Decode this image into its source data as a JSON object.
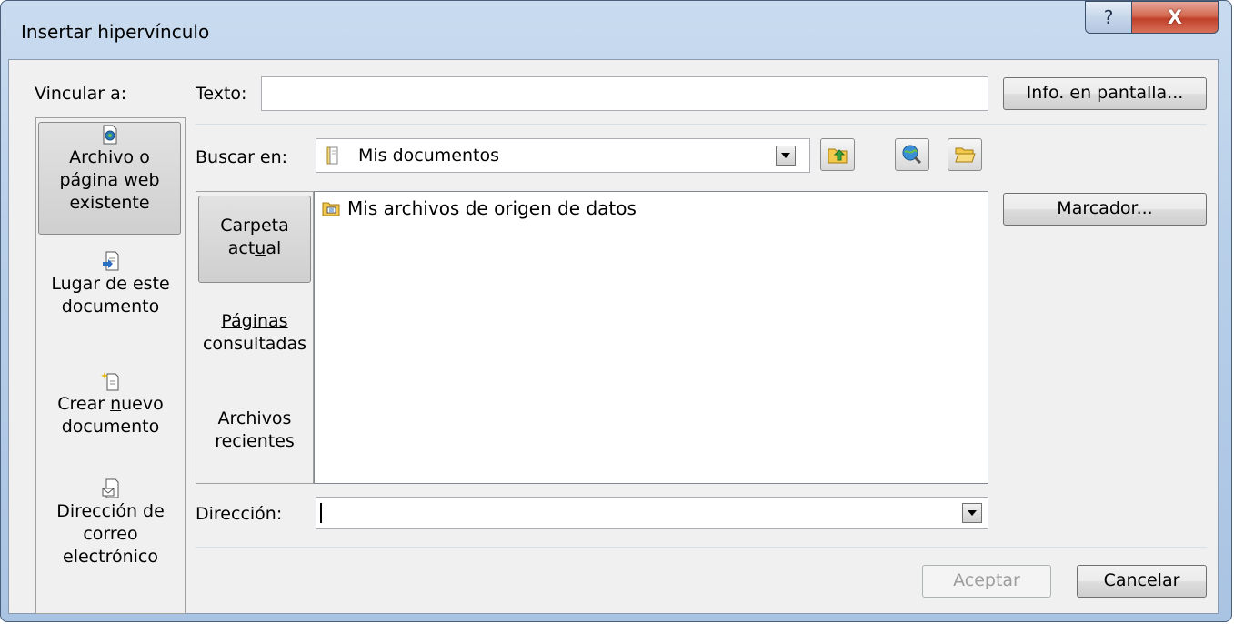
{
  "window": {
    "title": "Insertar hipervínculo",
    "help_label": "?",
    "close_label": "X"
  },
  "link_to": {
    "label": "Vincular a:",
    "items": [
      {
        "line1": "Archivo o",
        "line2": "página web",
        "line3": "existente",
        "icon": "existing-file-icon"
      },
      {
        "line1": "Lugar de este",
        "line2": "documento",
        "icon": "place-in-document-icon"
      },
      {
        "line1": "Crear nuevo",
        "line2": "documento",
        "icon": "new-document-icon"
      },
      {
        "line1": "Dirección de",
        "line2": "correo",
        "line3": "electrónico",
        "icon": "email-icon"
      }
    ]
  },
  "text_field": {
    "label": "Texto:",
    "value": ""
  },
  "screen_tip_button": "Info. en pantalla...",
  "look_in": {
    "label": "Buscar en:",
    "value": "Mis documentos"
  },
  "bookmark_button": "Marcador...",
  "tabs": [
    {
      "line1": "Carpeta",
      "line2": "actual"
    },
    {
      "line1": "Páginas",
      "line2": "consultadas"
    },
    {
      "line1": "Archivos",
      "line2": "recientes"
    }
  ],
  "files": [
    {
      "name": "Mis archivos de origen de datos",
      "icon": "data-source-folder-icon"
    }
  ],
  "address": {
    "label": "Dirección:",
    "value": ""
  },
  "ok_button": "Aceptar",
  "cancel_button": "Cancelar",
  "colors": {
    "titlebar": "#b8cfe9",
    "close": "#c94b35",
    "dialog_bg": "#f0f0f0"
  }
}
